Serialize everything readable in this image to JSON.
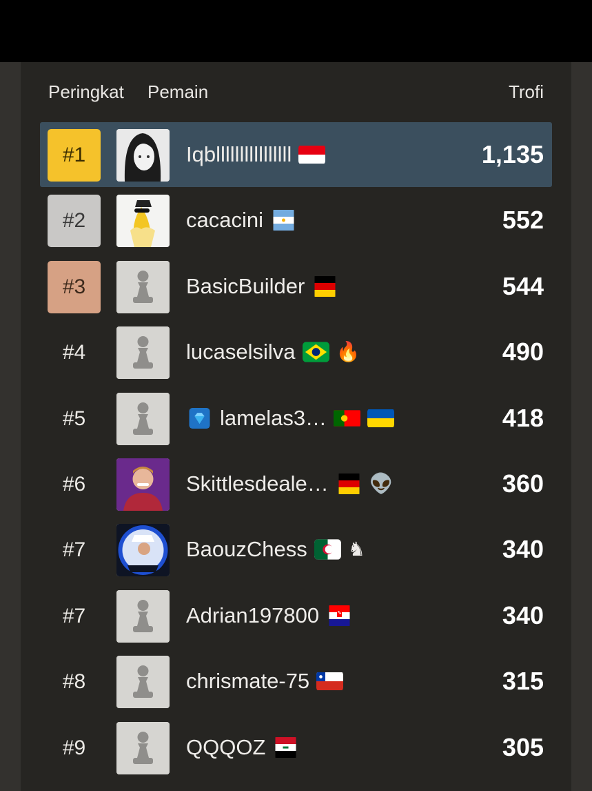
{
  "header": {
    "rank_label": "Peringkat",
    "player_label": "Pemain",
    "trophy_label": "Trofi"
  },
  "colors": {
    "highlight_row": "#3b4f5e",
    "gold": "#f5c22b",
    "silver": "#c9c8c6",
    "bronze": "#d6a184"
  },
  "rows": [
    {
      "rank": "#1",
      "name": "Iqbllllllllllllllll",
      "flags": [
        "indonesia-flag"
      ],
      "badges": [],
      "trophies": "1,135",
      "avatar": "anime-avatar",
      "highlight": true
    },
    {
      "rank": "#2",
      "name": "cacacini",
      "flags": [
        "argentina-flag"
      ],
      "badges": [],
      "trophies": "552",
      "avatar": "banana-avatar"
    },
    {
      "rank": "#3",
      "name": "BasicBuilder",
      "flags": [
        "germany-flag"
      ],
      "badges": [],
      "trophies": "544",
      "avatar": "pawn-avatar"
    },
    {
      "rank": "#4",
      "name": "lucaselsilva",
      "flags": [
        "brazil-flag"
      ],
      "badges": [
        "🔥"
      ],
      "trophies": "490",
      "avatar": "pawn-avatar"
    },
    {
      "rank": "#5",
      "name": "lamelas3…",
      "flags": [
        "portugal-flag",
        "ukraine-flag"
      ],
      "badges": [],
      "trophies": "418",
      "avatar": "pawn-avatar",
      "premium": true
    },
    {
      "rank": "#6",
      "name": "Skittlesdeale…",
      "flags": [
        "germany-flag"
      ],
      "badges": [
        "👽"
      ],
      "trophies": "360",
      "avatar": "photo-avatar"
    },
    {
      "rank": "#7",
      "name": "BaouzChess",
      "flags": [
        "algeria-flag"
      ],
      "badges": [
        "♞"
      ],
      "trophies": "340",
      "avatar": "baouz-avatar"
    },
    {
      "rank": "#7",
      "name": "Adrian197800",
      "flags": [
        "croatia-flag"
      ],
      "badges": [],
      "trophies": "340",
      "avatar": "pawn-avatar"
    },
    {
      "rank": "#8",
      "name": "chrismate-75",
      "flags": [
        "chile-flag"
      ],
      "badges": [],
      "trophies": "315",
      "avatar": "pawn-avatar"
    },
    {
      "rank": "#9",
      "name": "QQQOZ",
      "flags": [
        "iraq-flag"
      ],
      "badges": [],
      "trophies": "305",
      "avatar": "pawn-avatar"
    }
  ]
}
